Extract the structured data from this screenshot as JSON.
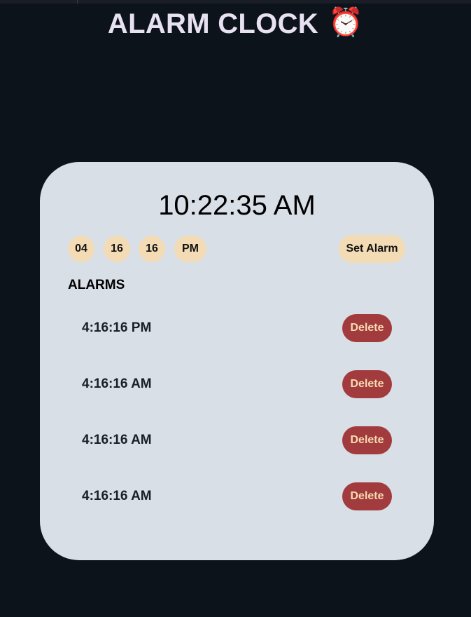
{
  "page": {
    "title": "ALARM CLOCK",
    "title_icon": "⏰"
  },
  "clock": {
    "current_time": "10:22:35 AM"
  },
  "alarm_form": {
    "hour": "04",
    "minute": "16",
    "second": "16",
    "ampm": "PM",
    "set_label": "Set Alarm"
  },
  "alarms": {
    "heading": "ALARMS",
    "items": [
      {
        "time": "4:16:16 PM",
        "delete_label": "Delete"
      },
      {
        "time": "4:16:16 AM",
        "delete_label": "Delete"
      },
      {
        "time": "4:16:16 AM",
        "delete_label": "Delete"
      },
      {
        "time": "4:16:16 AM",
        "delete_label": "Delete"
      }
    ]
  },
  "colors": {
    "background": "#0d131b",
    "card": "#d9dfe6",
    "pill": "#f3dcb5",
    "delete": "#a23b3e",
    "title": "#e7e1f2"
  }
}
